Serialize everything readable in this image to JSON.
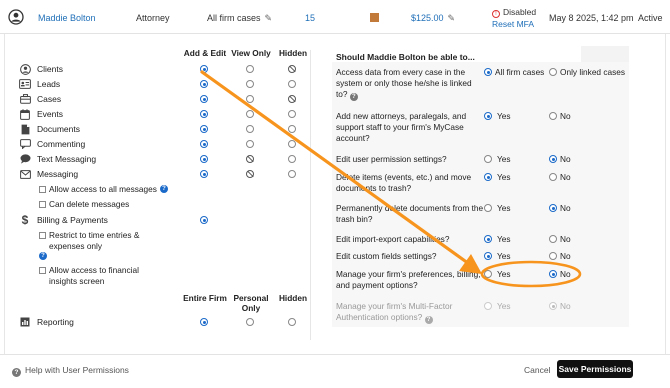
{
  "user": {
    "name": "Maddie Bolton",
    "role": "Attorney",
    "case_scope": "All firm cases",
    "count": "15",
    "rate": "$125.00",
    "rate_color": "#c27a3b",
    "mfa_status": "Disabled",
    "mfa_reset": "Reset MFA",
    "date": "May 8 2025, 1:42 pm",
    "status": "Active"
  },
  "permissions": {
    "headers": {
      "add_edit": "Add & Edit",
      "view_only": "View Only",
      "hidden": "Hidden"
    },
    "rows": [
      {
        "label": "Clients",
        "icon": "user-circle-icon",
        "value": "add_edit"
      },
      {
        "label": "Leads",
        "icon": "id-card-icon",
        "value": "add_edit"
      },
      {
        "label": "Cases",
        "icon": "briefcase-icon",
        "value": "add_edit"
      },
      {
        "label": "Events",
        "icon": "calendar-icon",
        "value": "add_edit"
      },
      {
        "label": "Documents",
        "icon": "document-icon",
        "value": "add_edit"
      },
      {
        "label": "Commenting",
        "icon": "comment-icon",
        "value": "add_edit"
      },
      {
        "label": "Text Messaging",
        "icon": "chat-bubble-icon",
        "value": "add_edit"
      },
      {
        "label": "Messaging",
        "icon": "envelope-icon",
        "value": "add_edit"
      }
    ],
    "messaging_options": {
      "allow_all": "Allow access to all messages",
      "can_delete": "Can delete messages"
    },
    "billing": {
      "label": "Billing & Payments",
      "icon": "dollar-icon",
      "value": "add_edit",
      "restrict": "Restrict to time entries & expenses only",
      "financial": "Allow access to financial insights screen"
    },
    "reporting_headers": {
      "entire_firm": "Entire Firm",
      "personal_only": "Personal Only",
      "hidden": "Hidden"
    },
    "reporting": {
      "label": "Reporting",
      "icon": "report-icon",
      "value": "entire_firm"
    }
  },
  "questions": {
    "title": "Should Maddie Bolton be able to...",
    "items": [
      {
        "text": "Access data from every case in the system or only those he/she is linked to?",
        "opt1": "All firm cases",
        "opt2": "Only linked cases",
        "value": 1,
        "help": true
      },
      {
        "text": "Add new attorneys, paralegals, and support staff to your firm's MyCase account?",
        "opt1": "Yes",
        "opt2": "No",
        "value": 1
      },
      {
        "text": "Edit user permission settings?",
        "opt1": "Yes",
        "opt2": "No",
        "value": 2
      },
      {
        "text": "Delete items (events, etc.) and move documents to trash?",
        "opt1": "Yes",
        "opt2": "No",
        "value": 1
      },
      {
        "text": "Permanently delete documents from the trash bin?",
        "opt1": "Yes",
        "opt2": "No",
        "value": 2
      },
      {
        "text": "Edit import-export capabilities?",
        "opt1": "Yes",
        "opt2": "No",
        "value": 1
      },
      {
        "text": "Edit custom fields settings?",
        "opt1": "Yes",
        "opt2": "No",
        "value": 1
      },
      {
        "text": "Manage your firm's preferences, billing, and payment options?",
        "opt1": "Yes",
        "opt2": "No",
        "value": 2
      },
      {
        "text": "Manage your firm's Multi-Factor Authentication options?",
        "opt1": "Yes",
        "opt2": "No",
        "value": 2,
        "disabled": true,
        "help": true
      }
    ]
  },
  "footer": {
    "help": "Help with User Permissions",
    "cancel": "Cancel",
    "save": "Save Permissions"
  },
  "annotation": {
    "color": "#f7941d"
  }
}
